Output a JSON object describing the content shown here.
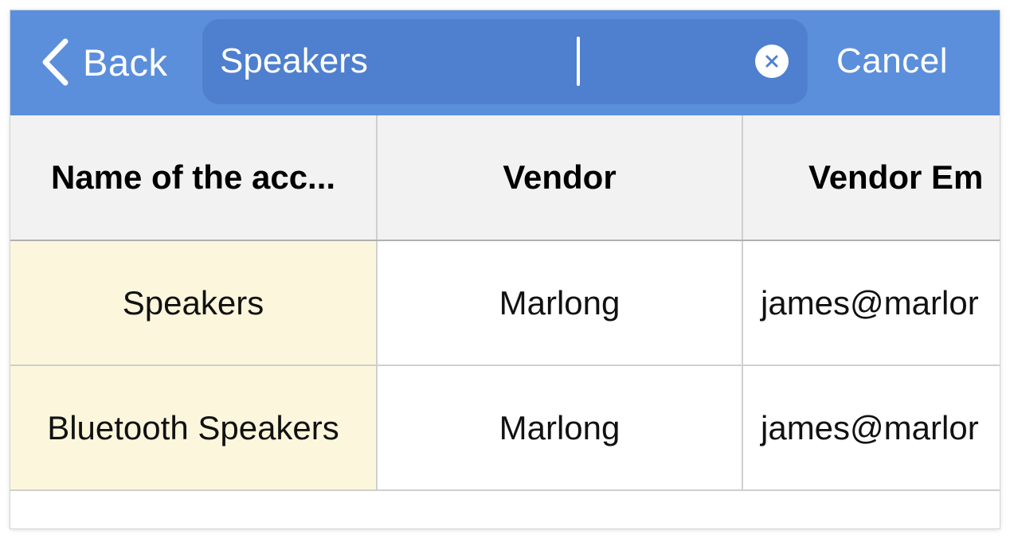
{
  "header": {
    "back_label": "Back",
    "cancel_label": "Cancel",
    "colors": {
      "bar": "#5b8fdb",
      "search_field": "#4f80cf"
    }
  },
  "search": {
    "value": "Speakers",
    "clear_icon": "clear-circle-icon"
  },
  "table": {
    "columns": [
      "Name of the acc...",
      "Vendor",
      "Vendor Em"
    ],
    "rows": [
      {
        "name": "Speakers",
        "vendor": "Marlong",
        "vendor_email": "james@marlor"
      },
      {
        "name": "Bluetooth Speakers",
        "vendor": "Marlong",
        "vendor_email": "james@marlor"
      }
    ],
    "colors": {
      "header_bg": "#f2f2f2",
      "name_column_bg": "#fcf7dc"
    }
  }
}
